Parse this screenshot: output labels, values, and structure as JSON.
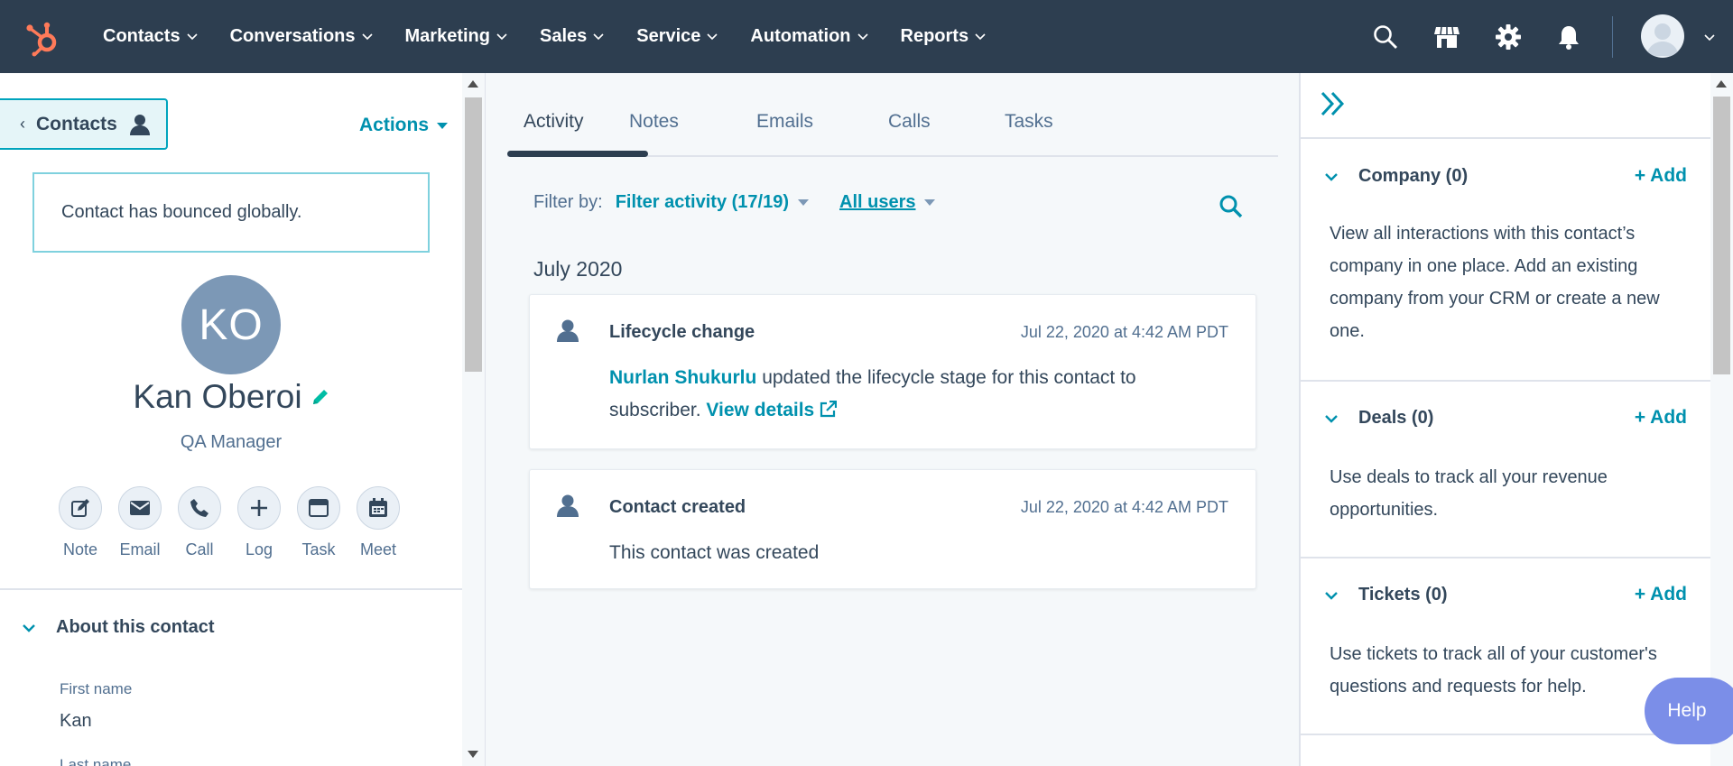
{
  "nav": {
    "logo": "hubspot-logo",
    "menu": [
      {
        "label": "Contacts"
      },
      {
        "label": "Conversations"
      },
      {
        "label": "Marketing"
      },
      {
        "label": "Sales"
      },
      {
        "label": "Service"
      },
      {
        "label": "Automation"
      },
      {
        "label": "Reports"
      }
    ],
    "icons": [
      "search-icon",
      "marketplace-icon",
      "settings-gear-icon",
      "notifications-bell-icon"
    ],
    "bg_color": "#2d3e50"
  },
  "left": {
    "back_label": "Contacts",
    "actions_label": "Actions",
    "bounce_message": "Contact has bounced globally.",
    "avatar_initials": "KO",
    "name": "Kan Oberoi",
    "job_title": "QA Manager",
    "quick_actions": [
      {
        "label": "Note",
        "icon": "note-icon"
      },
      {
        "label": "Email",
        "icon": "email-icon"
      },
      {
        "label": "Call",
        "icon": "phone-icon"
      },
      {
        "label": "Log",
        "icon": "plus-icon"
      },
      {
        "label": "Task",
        "icon": "task-icon"
      },
      {
        "label": "Meet",
        "icon": "calendar-icon"
      }
    ],
    "about_title": "About this contact",
    "properties": [
      {
        "label": "First name",
        "value": "Kan"
      },
      {
        "label": "Last name",
        "value": ""
      }
    ]
  },
  "center": {
    "tabs": [
      {
        "label": "Activity",
        "active": true
      },
      {
        "label": "Notes"
      },
      {
        "label": "Emails"
      },
      {
        "label": "Calls"
      },
      {
        "label": "Tasks"
      }
    ],
    "filter_label": "Filter by:",
    "filter_activity": "Filter activity (17/19)",
    "all_users": "All users",
    "month": "July 2020",
    "activities": [
      {
        "title": "Lifecycle change",
        "date": "Jul 22, 2020 at 4:42 AM PDT",
        "actor": "Nurlan Shukurlu",
        "text": " updated the lifecycle stage for this contact to subscriber. ",
        "link": "View details"
      },
      {
        "title": "Contact created",
        "date": "Jul 22, 2020 at 4:42 AM PDT",
        "text": "This contact was created"
      }
    ]
  },
  "right": {
    "sections": [
      {
        "title": "Company (0)",
        "add": "+ Add",
        "desc": "View all interactions with this contact’s company in one place. Add an existing company from your CRM or create a new one."
      },
      {
        "title": "Deals (0)",
        "add": "+ Add",
        "desc": "Use deals to track all your revenue opportunities."
      },
      {
        "title": "Tickets (0)",
        "add": "+ Add",
        "desc": "Use tickets to track all of your customer's questions and requests for help."
      }
    ]
  },
  "help_label": "Help",
  "colors": {
    "accent": "#0091ae",
    "text": "#33475b",
    "avatar": "#7c98b6",
    "help": "#7b8ee8"
  }
}
